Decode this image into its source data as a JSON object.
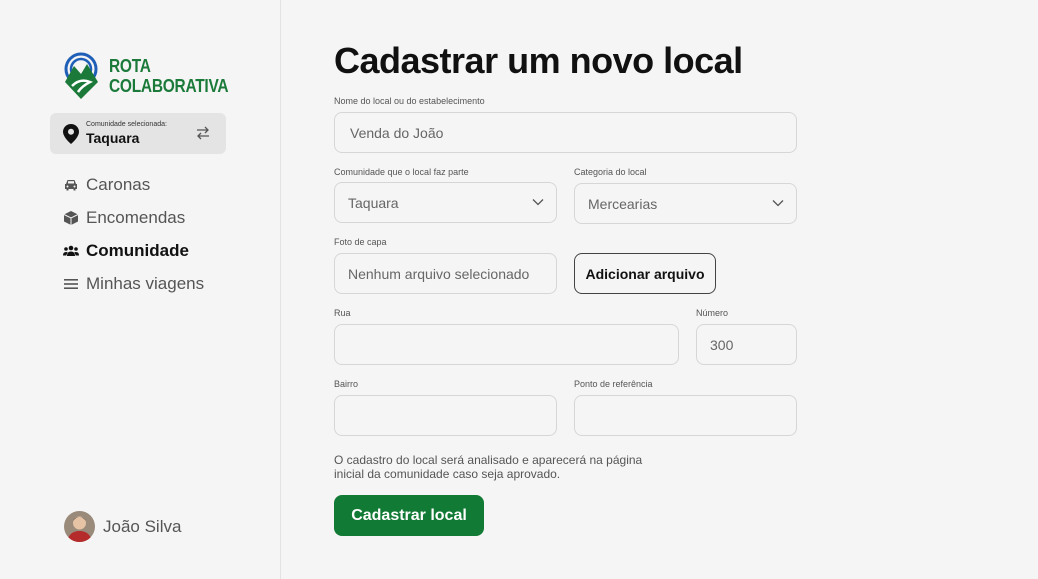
{
  "app": {
    "logo_line1": "ROTA",
    "logo_line2": "COLABORATIVA",
    "brand_color": "#1b7a3a"
  },
  "community": {
    "caption": "Comunidade selecionada:",
    "name": "Taquara"
  },
  "nav": [
    {
      "label": "Caronas",
      "icon": "car-icon",
      "active": false
    },
    {
      "label": "Encomendas",
      "icon": "package-icon",
      "active": false
    },
    {
      "label": "Comunidade",
      "icon": "people-icon",
      "active": true
    },
    {
      "label": "Minhas viagens",
      "icon": "list-icon",
      "active": false
    }
  ],
  "user": {
    "name": "João Silva"
  },
  "page": {
    "title": "Cadastrar um novo local"
  },
  "form": {
    "name_label": "Nome do local ou do estabelecimento",
    "name_value": "Venda do João",
    "community_label": "Comunidade que o local faz parte",
    "community_value": "Taquara",
    "category_label": "Categoria do local",
    "category_value": "Mercearias",
    "photo_label": "Foto de capa",
    "photo_value": "Nenhum arquivo selecionado",
    "add_file_button": "Adicionar arquivo",
    "street_label": "Rua",
    "street_value": "",
    "number_label": "Número",
    "number_value": "300",
    "district_label": "Bairro",
    "district_value": "",
    "reference_label": "Ponto de referência",
    "reference_value": "",
    "notice": "O cadastro do local será analisado e aparecerá na página inicial da comunidade caso seja aprovado.",
    "submit_button": "Cadastrar local",
    "submit_color": "#117a34"
  }
}
